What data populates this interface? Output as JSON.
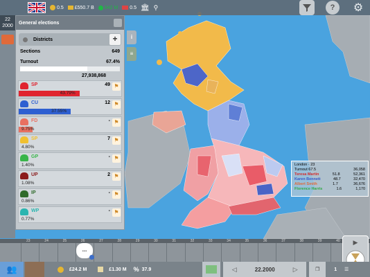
{
  "topbar": {
    "values": [
      "0.5",
      "£550.7 B",
      "942 M",
      "0.5"
    ],
    "colors": {
      "gold": "#e5b632",
      "green": "#1fb845"
    }
  },
  "date": {
    "day": "22",
    "year": "2000"
  },
  "panel": {
    "title": "General elections",
    "districts_label": "Districts",
    "sections_label": "Sections",
    "sections_value": "649",
    "turnout_label": "Turnout",
    "turnout_pct": "67.4%",
    "turnout_fraction": 0.674,
    "turnout_count": "27,938,868",
    "plus": "+",
    "parties": [
      {
        "name": "SP",
        "seats": "49",
        "pct": "43.79%",
        "share": 0.4379,
        "color": "#e0242f"
      },
      {
        "name": "CU",
        "seats": "12",
        "pct": "37.55%",
        "share": 0.3755,
        "color": "#2e5fd1"
      },
      {
        "name": "FD",
        "seats": "-",
        "pct": "9.75%",
        "share": 0.0975,
        "color": "#e87060"
      },
      {
        "name": "SP",
        "seats": "7",
        "pct": "4.80%",
        "share": 0.048,
        "color": "#f0c030"
      },
      {
        "name": "GP",
        "seats": "-",
        "pct": "1.40%",
        "share": 0.014,
        "color": "#39b54a"
      },
      {
        "name": "UP",
        "seats": "2",
        "pct": "1.08%",
        "share": 0.0108,
        "color": "#8b1c1c"
      },
      {
        "name": "IP",
        "seats": "-",
        "pct": "0.86%",
        "share": 0.0086,
        "color": "#2f6b2a"
      },
      {
        "name": "WP",
        "seats": "-",
        "pct": "0.77%",
        "share": 0.0077,
        "color": "#2ab5b0"
      }
    ]
  },
  "side_tabs": [
    "i",
    "≡"
  ],
  "tooltip": {
    "place": "London",
    "place_num": "23",
    "turnout_label": "Turnout",
    "turnout_pct": "67.5",
    "turnout_count": "36,058",
    "rows": [
      {
        "name": "Teresa Martin",
        "pct": "51.8",
        "votes": "52,361",
        "color": "#d42b2b"
      },
      {
        "name": "Karen Bennett",
        "pct": "48.7",
        "votes": "32,470",
        "color": "#3557c9"
      },
      {
        "name": "Albert Smith",
        "pct": "1.7",
        "votes": "36,676",
        "color": "#e06a3a"
      },
      {
        "name": "Florence Harris",
        "pct": "1.6",
        "votes": "1,170",
        "color": "#2ea844"
      }
    ]
  },
  "timeline": {
    "ticks": [
      "23",
      "24",
      "25",
      "26",
      "27",
      "28",
      "29",
      "30",
      "31",
      "32",
      "33",
      "34",
      "35",
      "36",
      "37",
      "38",
      "39",
      "40",
      "41"
    ],
    "chat_label": "..."
  },
  "bottombar": {
    "money": "£24.2 M",
    "income": "£1.30 M",
    "approval": "37.9",
    "date_display": "22.2000",
    "page": "1"
  },
  "icons": [
    "flag-uk-icon",
    "coins-icon",
    "people-icon",
    "bank-icon",
    "filter-icon",
    "help-icon",
    "settings-icon",
    "hourglass-icon"
  ]
}
